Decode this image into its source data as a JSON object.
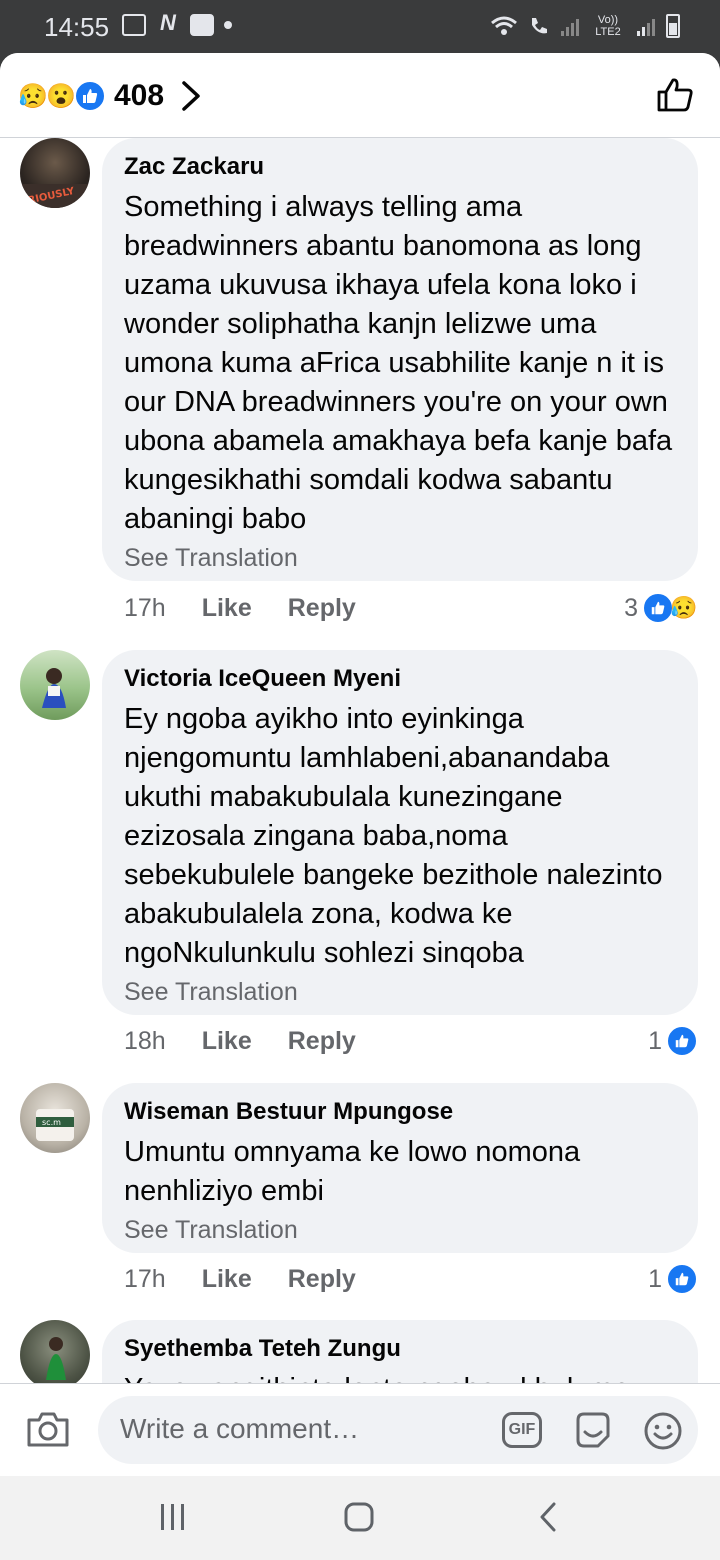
{
  "status": {
    "time": "14:55",
    "net_label": "Vo)) LTE2",
    "notif_icons": [
      "image-icon",
      "n-icon",
      "rocket-icon",
      "dot"
    ]
  },
  "header": {
    "reaction_count": "408",
    "reactions": [
      "sad",
      "wow",
      "like"
    ]
  },
  "comments": [
    {
      "author": "Zac Zackaru",
      "text": "Something i always telling ama breadwinners abantu banomona as long uzama ukuvusa ikhaya ufela kona loko i wonder soliphatha kanjn lelizwe uma umona kuma aFrica usabhilite kanje n it is our DNA breadwinners you're on your own ubona abamela amakhaya befa kanje bafa kungesikhathi somdali kodwa sabantu abaningi babo",
      "see_translation": "See Translation",
      "time": "17h",
      "like": "Like",
      "reply": "Reply",
      "reaction_count": "3"
    },
    {
      "author": "Victoria IceQueen Myeni",
      "text": "Ey ngoba ayikho into eyinkinga njengomuntu lamhlabeni,abanandaba ukuthi mabakubulala kunezingane ezizosala zingana baba,noma sebekubulele bangeke bezithole nalezinto abakubulalela zona, kodwa ke ngoNkulunkulu sohlezi sinqoba",
      "see_translation": "See Translation",
      "time": "18h",
      "like": "Like",
      "reply": "Reply",
      "reaction_count": "1"
    },
    {
      "author": "Wiseman Bestuur Mpungose",
      "text": "Umuntu omnyama ke lowo nomona nenhliziyo embi",
      "see_translation": "See Translation",
      "time": "17h",
      "like": "Like",
      "reply": "Reply",
      "reaction_count": "1"
    },
    {
      "author": "Syethemba Teteh Zungu",
      "text": "Yaze yangithinta lento ngoba ukhulume"
    }
  ],
  "composer": {
    "placeholder": "Write a comment…",
    "gif_label": "GIF"
  },
  "colors": {
    "accent": "#1877f2",
    "bubble": "#f0f2f5",
    "muted": "#65676b"
  }
}
